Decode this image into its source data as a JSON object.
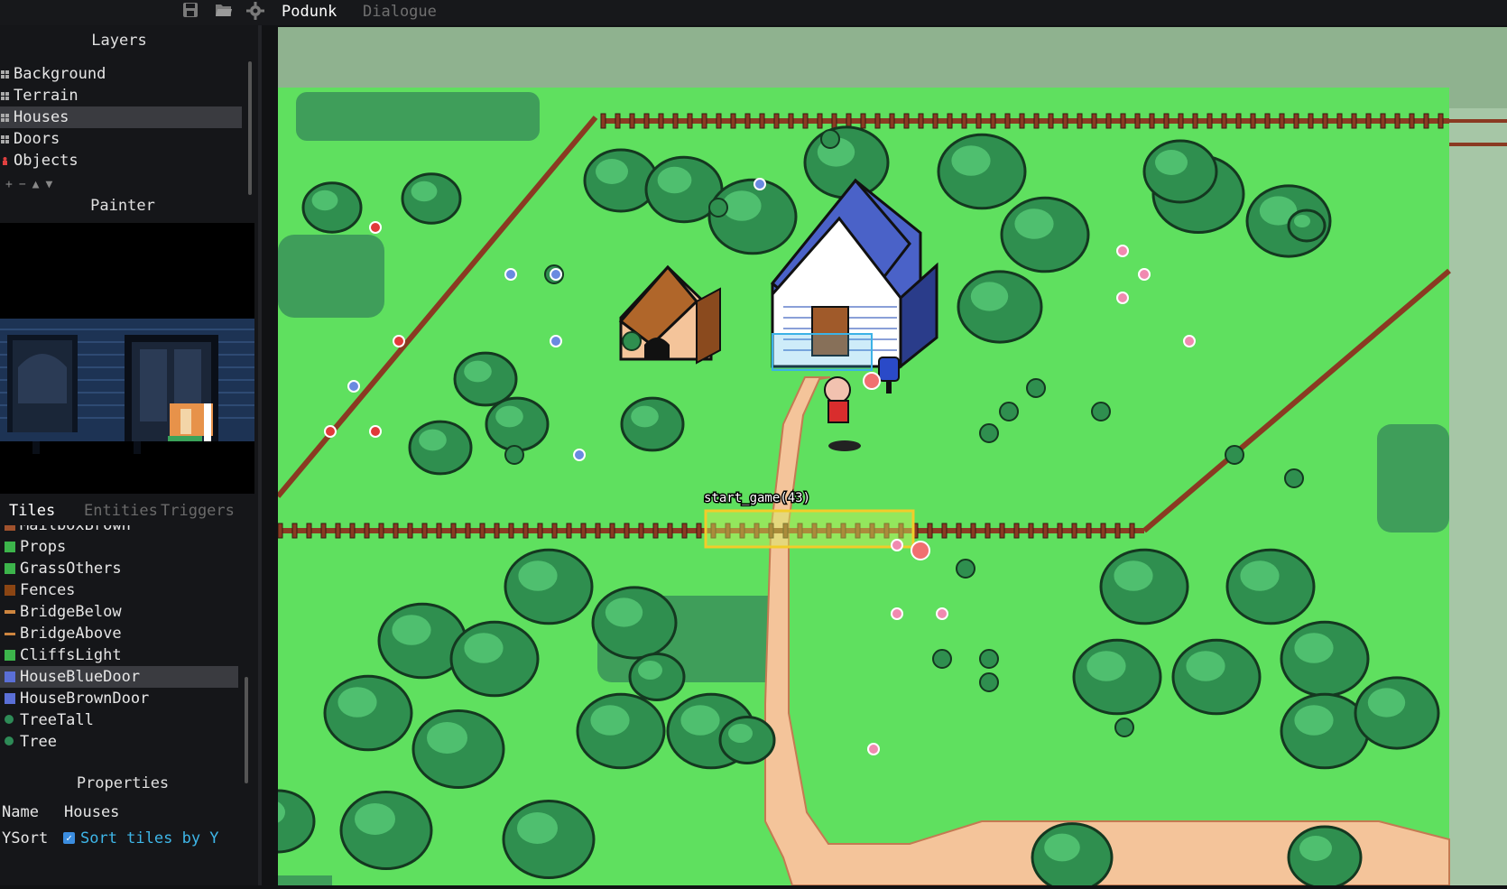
{
  "topbar": {
    "icons": [
      "save-icon",
      "folder-open-icon",
      "gear-icon"
    ],
    "tabs": [
      {
        "label": "Podunk",
        "active": true
      },
      {
        "label": "Dialogue",
        "active": false
      }
    ]
  },
  "layers": {
    "title": "Layers",
    "items": [
      {
        "label": "Background",
        "icon": "grid-icon"
      },
      {
        "label": "Terrain",
        "icon": "grid-icon"
      },
      {
        "label": "Houses",
        "icon": "grid-icon",
        "selected": true
      },
      {
        "label": "Doors",
        "icon": "grid-icon"
      },
      {
        "label": "Objects",
        "icon": "person-icon"
      }
    ],
    "controls": [
      "+",
      "−",
      "▲",
      "▼"
    ]
  },
  "painter": {
    "title": "Painter"
  },
  "bottom_tabs": [
    {
      "label": "Tiles",
      "active": true
    },
    {
      "label": "Entities",
      "active": false
    },
    {
      "label": "Triggers",
      "active": false
    }
  ],
  "tiles": {
    "items": [
      {
        "label": "MailboxBrown",
        "color": "#a0522d"
      },
      {
        "label": "Props",
        "color": "#3cb44b"
      },
      {
        "label": "GrassOthers",
        "color": "#3cb44b"
      },
      {
        "label": "Fences",
        "color": "#8b4513"
      },
      {
        "label": "BridgeBelow",
        "color": "#cd853f"
      },
      {
        "label": "BridgeAbove",
        "color": "#cd853f"
      },
      {
        "label": "CliffsLight",
        "color": "#3cb44b"
      },
      {
        "label": "HouseBlueDoor",
        "color": "#5a6fd6",
        "selected": true
      },
      {
        "label": "HouseBrownDoor",
        "color": "#5a6fd6"
      },
      {
        "label": "TreeTall",
        "color": "#2e8b57"
      },
      {
        "label": "Tree",
        "color": "#2e8b57"
      }
    ]
  },
  "properties": {
    "title": "Properties",
    "name_label": "Name",
    "name_value": "Houses",
    "ysort_label": "YSort",
    "ysort_checked": true,
    "ysort_text": "Sort tiles by Y"
  },
  "map": {
    "trigger_label": "start_game(43)"
  },
  "colors": {
    "grass": "#5fe05f",
    "dark_grass": "#3f9e5a",
    "outside": "#8faf8f",
    "path": "#f4c49a",
    "fence": "#8a3a22",
    "tree": "#2f8f4f",
    "roof_blue": "#4a62c8",
    "trigger_yellow": "#f2cc2a",
    "selection_blue": "#3cb2e6"
  }
}
